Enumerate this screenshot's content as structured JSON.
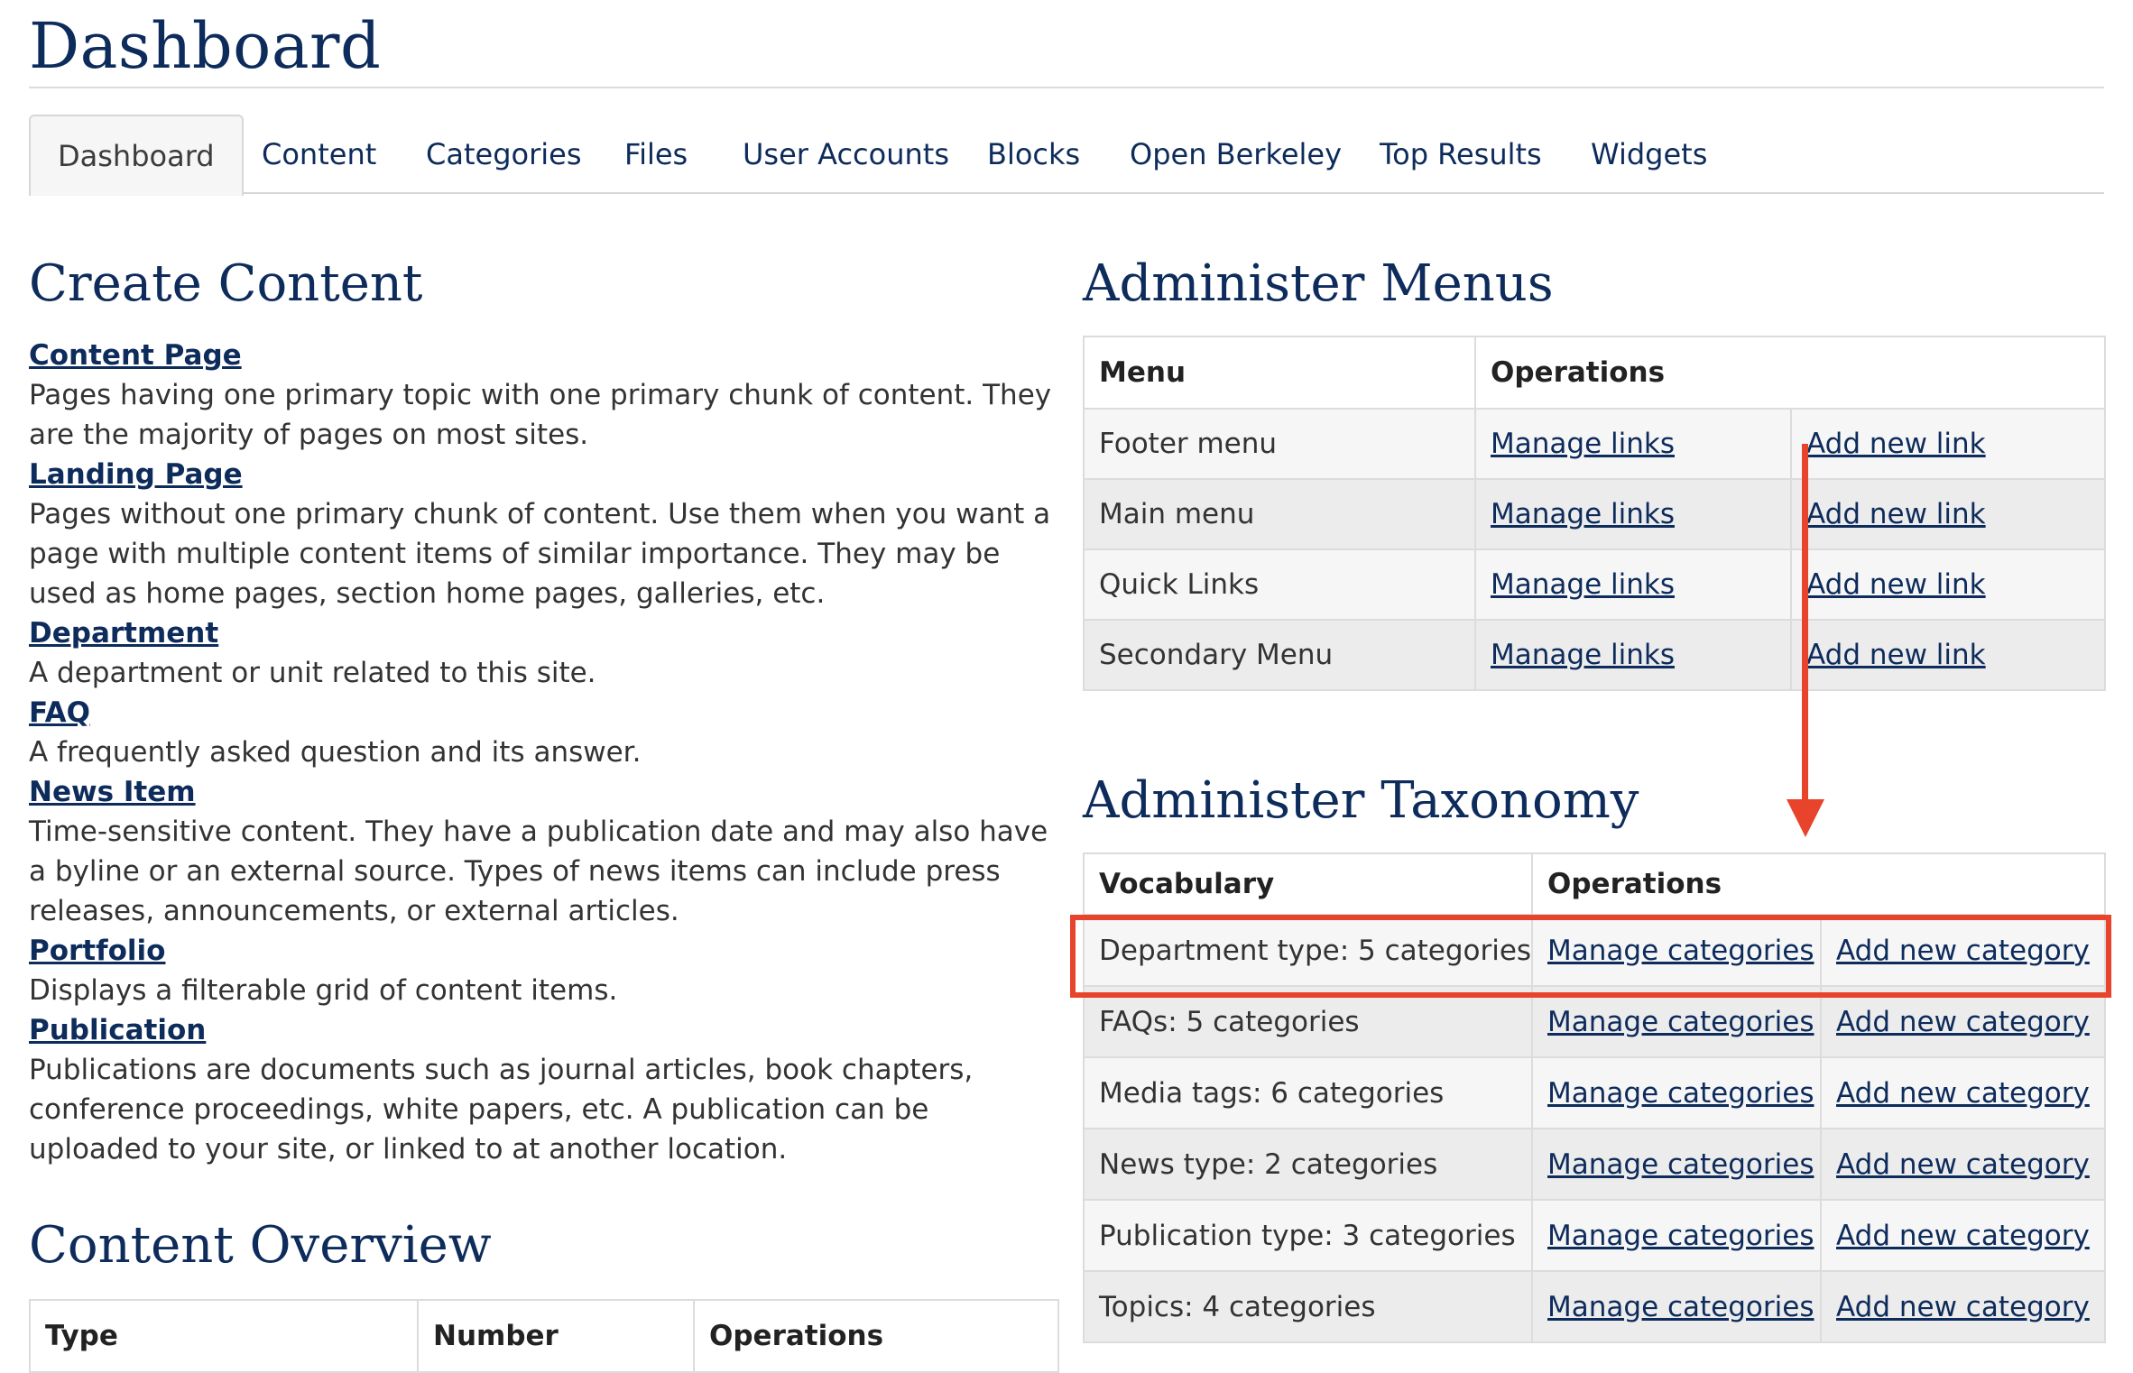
{
  "page": {
    "title": "Dashboard"
  },
  "tabs": [
    {
      "label": "Dashboard",
      "active": true
    },
    {
      "label": "Content"
    },
    {
      "label": "Categories"
    },
    {
      "label": "Files"
    },
    {
      "label": "User Accounts"
    },
    {
      "label": "Blocks"
    },
    {
      "label": "Open Berkeley"
    },
    {
      "label": "Top Results"
    },
    {
      "label": "Widgets"
    }
  ],
  "create_content": {
    "heading": "Create Content",
    "items": [
      {
        "title": "Content Page",
        "description": "Pages having one primary topic with one primary chunk of content. They are the majority of pages on most sites."
      },
      {
        "title": "Landing Page",
        "description": "Pages without one primary chunk of content. Use them when you want a page with multiple content items of similar importance. They may be used as home pages, section home pages, galleries, etc."
      },
      {
        "title": "Department",
        "description": "A department or unit related to this site."
      },
      {
        "title": "FAQ",
        "description": "A frequently asked question and its answer."
      },
      {
        "title": "News Item",
        "description": "Time-sensitive content. They have a publication date and may also have a byline or an external source. Types of news items can include press releases, announcements, or external articles."
      },
      {
        "title": "Portfolio",
        "description": "Displays a filterable grid of content items."
      },
      {
        "title": "Publication",
        "description": "Publications are documents such as journal articles, book chapters, conference proceedings, white papers, etc. A publication can be uploaded to your site, or linked to at another location."
      }
    ]
  },
  "content_overview": {
    "heading": "Content Overview",
    "columns": [
      "Type",
      "Number",
      "Operations"
    ]
  },
  "administer_menus": {
    "heading": "Administer Menus",
    "columns": [
      "Menu",
      "Operations"
    ],
    "rows": [
      {
        "name": "Footer menu",
        "manage": "Manage links",
        "add": "Add new link"
      },
      {
        "name": "Main menu",
        "manage": "Manage links",
        "add": "Add new link"
      },
      {
        "name": "Quick Links",
        "manage": "Manage links",
        "add": "Add new link"
      },
      {
        "name": "Secondary Menu",
        "manage": "Manage links",
        "add": "Add new link"
      }
    ]
  },
  "administer_taxonomy": {
    "heading": "Administer Taxonomy",
    "columns": [
      "Vocabulary",
      "Operations"
    ],
    "rows": [
      {
        "name": "Department type: 5 categories",
        "manage": "Manage categories",
        "add": "Add new category"
      },
      {
        "name": "FAQs: 5 categories",
        "manage": "Manage categories",
        "add": "Add new category"
      },
      {
        "name": "Media tags: 6 categories",
        "manage": "Manage categories",
        "add": "Add new category"
      },
      {
        "name": "News type: 2 categories",
        "manage": "Manage categories",
        "add": "Add new category"
      },
      {
        "name": "Publication type: 3 categories",
        "manage": "Manage categories",
        "add": "Add new category"
      },
      {
        "name": "Topics: 4 categories",
        "manage": "Manage categories",
        "add": "Add new category"
      }
    ]
  },
  "annotation": {
    "color": "#e8432b"
  }
}
